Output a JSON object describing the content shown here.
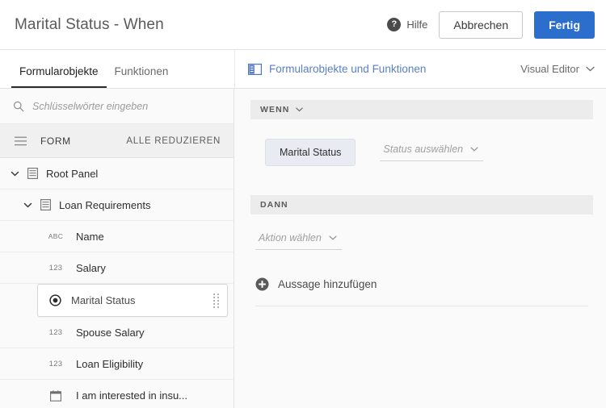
{
  "header": {
    "title": "Marital Status - When",
    "help_label": "Hilfe",
    "help_icon": "question-circle-icon",
    "cancel_label": "Abbrechen",
    "done_label": "Fertig",
    "primary_color": "#2c6ecb"
  },
  "strip": {
    "tabs": [
      {
        "label": "Formularobjekte",
        "active": true
      },
      {
        "label": "Funktionen",
        "active": false
      }
    ],
    "objects_link": "Formularobjekte und Funktionen",
    "objects_icon": "panel-layout-icon",
    "editor_select": "Visual Editor",
    "editor_chevron": "chevron-down-icon",
    "link_color": "#5b7fc4"
  },
  "sidebar": {
    "search_placeholder": "Schlüsselwörter eingeben",
    "search_value": "",
    "search_icon": "search-icon",
    "form_label": "FORM",
    "form_icon": "hamburger-icon",
    "collapse_all": "ALLE REDUZIEREN",
    "tree": [
      {
        "label": "Root Panel",
        "icon": "panel-icon",
        "type": "",
        "depth": 0,
        "chevron": "chevron-down-icon",
        "selected": false
      },
      {
        "label": "Loan Requirements",
        "icon": "panel-icon",
        "type": "",
        "depth": 1,
        "chevron": "chevron-down-icon",
        "selected": false
      },
      {
        "label": "Name",
        "icon": "text-icon",
        "type": "ABC",
        "depth": 2,
        "chevron": "",
        "selected": false
      },
      {
        "label": "Salary",
        "icon": "number-icon",
        "type": "123",
        "depth": 2,
        "chevron": "",
        "selected": false
      },
      {
        "label": "Marital Status",
        "icon": "radio-icon",
        "type": "",
        "depth": 2,
        "chevron": "",
        "selected": true,
        "drag_handle": "drag-handle-icon"
      },
      {
        "label": "Spouse Salary",
        "icon": "number-icon",
        "type": "123",
        "depth": 2,
        "chevron": "",
        "selected": false
      },
      {
        "label": "Loan Eligibility",
        "icon": "number-icon",
        "type": "123",
        "depth": 2,
        "chevron": "",
        "selected": false
      },
      {
        "label": "I am interested in insu...",
        "icon": "calendar-icon",
        "type": "",
        "depth": 2,
        "chevron": "",
        "selected": false
      }
    ]
  },
  "rule": {
    "when_title": "WENN",
    "when_chevron": "chevron-down-icon",
    "when_object": "Marital Status",
    "when_operator_placeholder": "Status auswählen",
    "when_operator_chevron": "chevron-down-icon",
    "then_title": "DANN",
    "then_action_placeholder": "Aktion wählen",
    "then_action_chevron": "chevron-down-icon",
    "add_statement": "Aussage hinzufügen",
    "add_icon": "plus-circle-icon"
  }
}
